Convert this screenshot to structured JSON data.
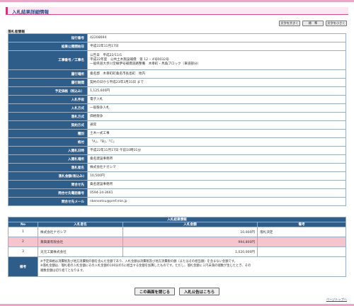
{
  "header": {
    "title": "入札結果詳細情報"
  },
  "font_controls": {
    "larger": "文字を大きく",
    "standard": "標　準",
    "smaller": "文字を小さく"
  },
  "section_label": "落札者情報",
  "detail_rows": [
    {
      "label": "指行番号",
      "value": "42208694"
    },
    {
      "label": "結果公開開始日",
      "value": "平成22年11月17日"
    },
    {
      "label": "工事番号／工事名",
      "value_lines": [
        "公告日　平成22/11/1",
        "平成22年度　公共土木施設補償　第 12 ‒ 4号0032号",
        "一般県道大歩川堂線伊号補償道路整備　木幸町・馬角ブロック（車道部分）"
      ]
    },
    {
      "label": "履行場所",
      "value": "桑名郡　木幸町町桑名市長島町　地内"
    },
    {
      "label": "履行期間",
      "value": "契約の日から平成23年3月31日 まで"
    },
    {
      "label": "予定価格（税込み）",
      "value": "1,125,600円"
    },
    {
      "label": "入札手段",
      "value": "電子入札"
    },
    {
      "label": "入札方式",
      "value": "一般競争入札"
    },
    {
      "label": "落札方式",
      "value": "価格競争"
    },
    {
      "label": "契約方式",
      "value": "通常"
    },
    {
      "label": "種別",
      "value": "土木一式工事"
    },
    {
      "label": "格付",
      "value": "「A」、「B」、「C」"
    },
    {
      "label": "入開札日時",
      "value": "平成22年11月17日 午前10時31分"
    },
    {
      "label": "入開札場所",
      "value": "桑名建設事務所"
    },
    {
      "label": "落札者名",
      "value": "株式会社ナガシマ"
    },
    {
      "label": "落札金額(税込み)",
      "value": "10,500円"
    },
    {
      "label": "問合せ先",
      "value": "桑名建設事務所"
    },
    {
      "label": "問合せ先電話番号",
      "value": "0594-24-3661"
    },
    {
      "label": "問合せ先メール",
      "value": "nkensetsu@pref.mie.jp"
    }
  ],
  "results": {
    "caption": "入札結果情報",
    "columns": [
      "No",
      "入札者名",
      "入札金額",
      "備考"
    ],
    "rows": [
      {
        "no": "1",
        "name": "株式会社ナガシマ",
        "amount": "10,000円",
        "note": "落札決定"
      },
      {
        "no": "2",
        "name": "蔦興業有限会社",
        "amount": "994,800円",
        "note": ""
      },
      {
        "no": "3",
        "name": "天元工業株式会社",
        "amount": "1,020,000円",
        "note": ""
      }
    ],
    "note_label": "備考",
    "note_lines": [
      "※予定価格は消費税及び地方消費税の額を含んだ金額であり、入札金額は消費税及び地方消費税の額（またはその相当額）を含まない金額です。",
      "※落札金額は、落札者の入札金額にその入札金額の100分の5に相当する金額を加算したものです。ただし、落札金額に１円未満の端数が生じたとき、その",
      "端数金額は切り捨てとなります。"
    ]
  },
  "buttons": {
    "close": "この画面を閉じる",
    "notice": "入札公告はこちら"
  },
  "page_top": "ページトップへ"
}
